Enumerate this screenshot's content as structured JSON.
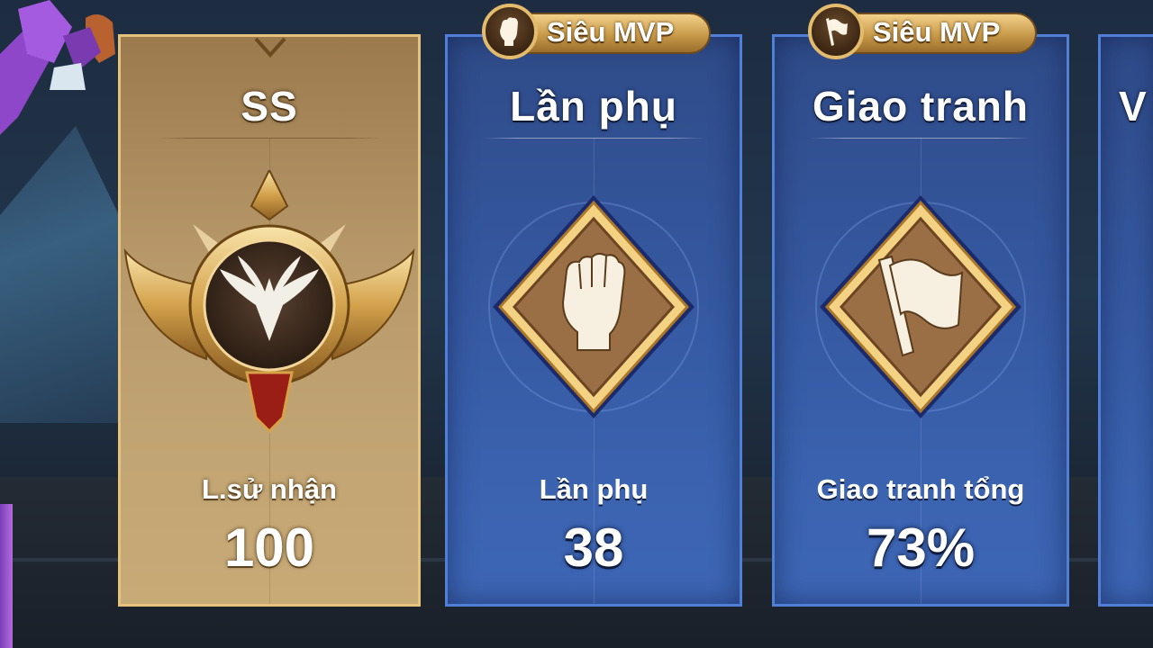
{
  "cards": [
    {
      "title": "SS",
      "label": "L.sử nhận",
      "value": "100",
      "emblem": "winged-medal-icon"
    },
    {
      "title": "Lần phụ",
      "label": "Lần phụ",
      "value": "38",
      "emblem": "fist-icon",
      "badge": {
        "text": "Siêu MVP",
        "icon": "fist-badge-icon"
      }
    },
    {
      "title": "Giao tranh",
      "label": "Giao tranh tổng",
      "value": "73%",
      "emblem": "flag-icon",
      "badge": {
        "text": "Siêu MVP",
        "icon": "flag-badge-icon"
      }
    },
    {
      "title": "V",
      "partial": true
    }
  ],
  "colors": {
    "gold_card": "#b8996a",
    "blue_card": "#3558a0",
    "gold_border": "#e7c27a",
    "blue_border": "#4f7fd6"
  }
}
